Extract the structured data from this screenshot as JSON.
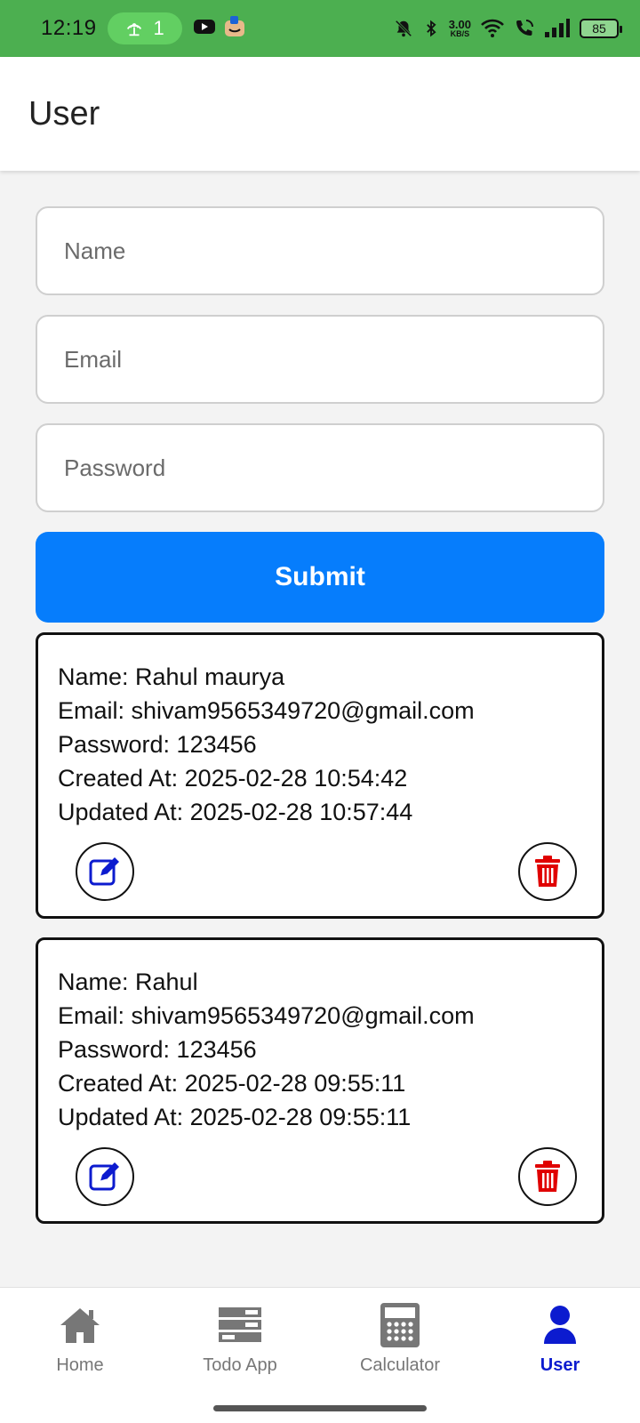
{
  "status_bar": {
    "time": "12:19",
    "hotspot_count": "1",
    "net_speed_value": "3.00",
    "net_speed_unit": "KB/S",
    "battery": "85",
    "icons": [
      "hotspot-icon",
      "youtube-icon",
      "app-icon",
      "mute-icon",
      "bluetooth-icon",
      "wifi-icon",
      "wifi-call-icon",
      "signal-icon",
      "battery-icon"
    ]
  },
  "appbar": {
    "title": "User"
  },
  "form": {
    "name_placeholder": "Name",
    "email_placeholder": "Email",
    "password_placeholder": "Password",
    "submit_label": "Submit"
  },
  "users": [
    {
      "name": "Name: Rahul maurya",
      "email": "Email: shivam9565349720@gmail.com",
      "password": "Password: 123456",
      "created": "Created At: 2025-02-28 10:54:42",
      "updated": "Updated At: 2025-02-28 10:57:44"
    },
    {
      "name": "Name: Rahul",
      "email": "Email: shivam9565349720@gmail.com",
      "password": "Password: 123456",
      "created": "Created At: 2025-02-28 09:55:11",
      "updated": "Updated At: 2025-02-28 09:55:11"
    }
  ],
  "nav": {
    "items": [
      {
        "label": "Home",
        "icon": "home-icon"
      },
      {
        "label": "Todo App",
        "icon": "list-icon"
      },
      {
        "label": "Calculator",
        "icon": "calculator-icon"
      },
      {
        "label": "User",
        "icon": "user-icon",
        "active": true
      }
    ]
  },
  "colors": {
    "status_bar": "#4caf50",
    "primary_button": "#067dfc",
    "edit_icon": "#0c1bcf",
    "delete_icon": "#e00000",
    "nav_active": "#0c1bcf",
    "nav_inactive": "#777777"
  }
}
